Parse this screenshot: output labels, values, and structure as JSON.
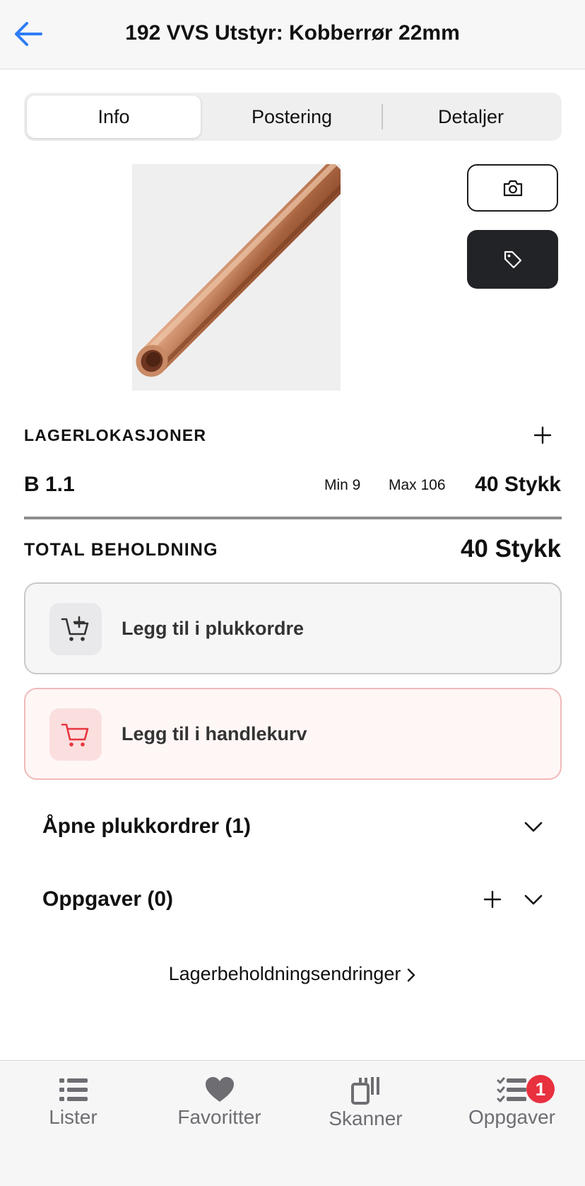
{
  "header": {
    "title": "192 VVS Utstyr: Kobberrør 22mm",
    "back_icon": "arrow-left-icon",
    "accent_color": "#2e7cf6"
  },
  "tabs": [
    {
      "label": "Info",
      "active": true
    },
    {
      "label": "Postering",
      "active": false
    },
    {
      "label": "Detaljer",
      "active": false
    }
  ],
  "product": {
    "image": "copper-pipe-image",
    "camera_icon": "camera-icon",
    "tag_icon": "tag-icon"
  },
  "locations": {
    "heading": "LAGERLOKASJONER",
    "add_icon": "plus-icon",
    "items": [
      {
        "name": "B 1.1",
        "min": "Min 9",
        "max": "Max 106",
        "qty": "40 Stykk"
      }
    ]
  },
  "total": {
    "label": "TOTAL BEHOLDNING",
    "value": "40 Stykk"
  },
  "actions": {
    "pick_order": {
      "label": "Legg til i plukkordre",
      "icon": "cart-plus-icon"
    },
    "shopping_cart": {
      "label": "Legg til i handlekurv",
      "icon": "cart-icon",
      "color": "#e8363f"
    }
  },
  "sections": {
    "open_orders": "Åpne plukkordrer (1)",
    "tasks": "Oppgaver (0)"
  },
  "changes_link": "Lagerbeholdningsendringer",
  "tabbar": [
    {
      "label": "Lister",
      "icon": "list-icon"
    },
    {
      "label": "Favoritter",
      "icon": "heart-icon"
    },
    {
      "label": "Skanner",
      "icon": "scanner-icon"
    },
    {
      "label": "Oppgaver",
      "icon": "checklist-icon",
      "badge": "1"
    }
  ]
}
